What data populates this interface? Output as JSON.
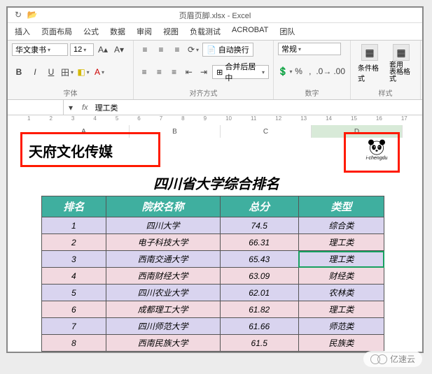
{
  "app": {
    "title": "页眉页脚.xlsx - Excel"
  },
  "qat": {
    "redo": "↻",
    "open": "📂"
  },
  "tabs": [
    "插入",
    "页面布局",
    "公式",
    "数据",
    "审阅",
    "视图",
    "负载测试",
    "ACROBAT",
    "团队"
  ],
  "font": {
    "name": "华文隶书",
    "size": "12",
    "grow": "A▴",
    "shrink": "A▾",
    "bold": "B",
    "italic": "I",
    "underline": "U",
    "border": "田",
    "fill": "◧",
    "color": "A",
    "group": "字体"
  },
  "align": {
    "top": "≡",
    "mid": "≡",
    "bot": "≡",
    "rot": "⟳",
    "left": "≡",
    "center": "≡",
    "right": "≡",
    "indL": "⇤",
    "indR": "⇥",
    "wrap": "自动换行",
    "merge": "合并后居中",
    "group": "对齐方式"
  },
  "number": {
    "fmt": "常规",
    "cur": "%",
    "pct": "%",
    "comma": ",",
    "inc": "+0",
    "dec": "-0",
    "group": "数字"
  },
  "styles": {
    "cond": "条件格式",
    "tbl": "套用\n表格格式",
    "group": "样式"
  },
  "fx": {
    "cell": "",
    "label": "fx",
    "value": "理工类"
  },
  "cols": [
    "A",
    "B",
    "C",
    "D"
  ],
  "ruler": [
    "1",
    "2",
    "3",
    "4",
    "5",
    "6",
    "7",
    "8",
    "9",
    "10",
    "11",
    "12",
    "13",
    "14",
    "15",
    "16",
    "17"
  ],
  "doc": {
    "header_left": "天府文化传媒",
    "header_right_caption": "i-chengdu",
    "title": "四川省大学综合排名"
  },
  "chart_data": {
    "type": "table",
    "columns": [
      "排名",
      "院校名称",
      "总分",
      "类型"
    ],
    "rows": [
      {
        "rank": "1",
        "name": "四川大学",
        "score": "74.5",
        "type": "综合类"
      },
      {
        "rank": "2",
        "name": "电子科技大学",
        "score": "66.31",
        "type": "理工类"
      },
      {
        "rank": "3",
        "name": "西南交通大学",
        "score": "65.43",
        "type": "理工类"
      },
      {
        "rank": "4",
        "name": "西南财经大学",
        "score": "63.09",
        "type": "财经类"
      },
      {
        "rank": "5",
        "name": "四川农业大学",
        "score": "62.01",
        "type": "农林类"
      },
      {
        "rank": "6",
        "name": "成都理工大学",
        "score": "61.82",
        "type": "理工类"
      },
      {
        "rank": "7",
        "name": "四川师范大学",
        "score": "61.66",
        "type": "师范类"
      },
      {
        "rank": "8",
        "name": "西南民族大学",
        "score": "61.5",
        "type": "民族类"
      }
    ],
    "selected_cell": {
      "row": 2,
      "col": "type"
    }
  },
  "watermark": "亿速云"
}
